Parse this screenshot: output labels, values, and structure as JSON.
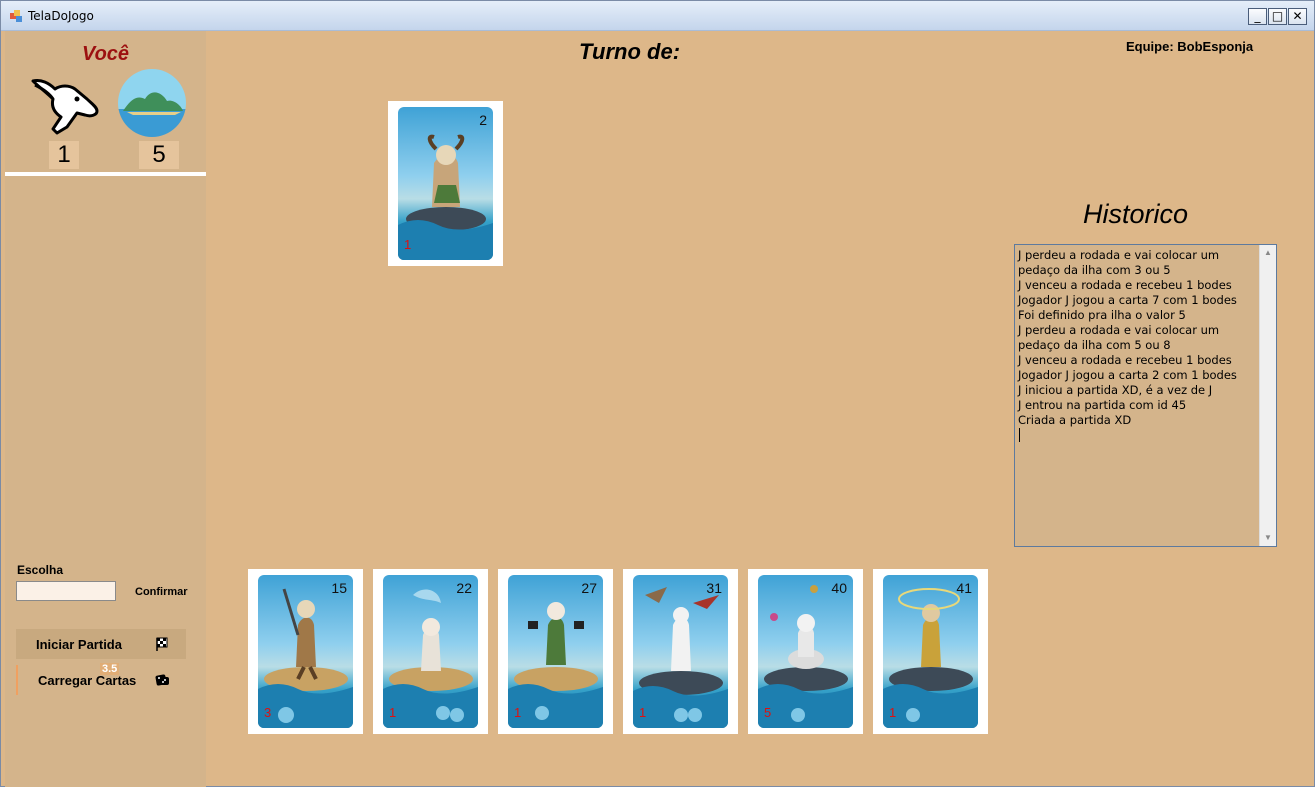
{
  "window": {
    "title": "TelaDoJogo",
    "minimize_glyph": "_",
    "maximize_glyph": "□",
    "close_glyph": "✕"
  },
  "player": {
    "label": "Você",
    "goats": "1",
    "island": "5"
  },
  "turn": {
    "label": "Turno de:"
  },
  "team": {
    "label": "Equipe: BobEsponja"
  },
  "played_card": {
    "number": "2",
    "goats": "1"
  },
  "hand": [
    {
      "number": "15",
      "goats": "3"
    },
    {
      "number": "22",
      "goats": "1"
    },
    {
      "number": "27",
      "goats": "1"
    },
    {
      "number": "31",
      "goats": "1"
    },
    {
      "number": "40",
      "goats": "5"
    },
    {
      "number": "41",
      "goats": "1"
    }
  ],
  "choice": {
    "label": "Escolha",
    "value": "",
    "confirm_label": "Confirmar"
  },
  "buttons": {
    "start_label": "Iniciar Partida",
    "load_label": "Carregar Cartas",
    "load_badge": "3.5"
  },
  "history": {
    "title": "Historico",
    "lines": [
      "J perdeu a rodada e vai colocar um",
      "pedaço da ilha com 3 ou 5",
      "J venceu a rodada e recebeu 1 bodes",
      "Jogador J jogou a carta 7 com 1 bodes",
      "Foi definido pra ilha o valor 5",
      "J perdeu a rodada e vai colocar um",
      "pedaço da ilha com 5 ou 8",
      "J venceu a rodada e recebeu 1 bodes",
      "Jogador J jogou a carta 2 com 1 bodes",
      "J iniciou a partida XD, é a vez de J",
      "J entrou na partida com id 45",
      "Criada a partida XD"
    ]
  },
  "colors": {
    "background": "#ddb789",
    "sidebar": "#d4b48b",
    "accent_red": "#9c1010"
  }
}
